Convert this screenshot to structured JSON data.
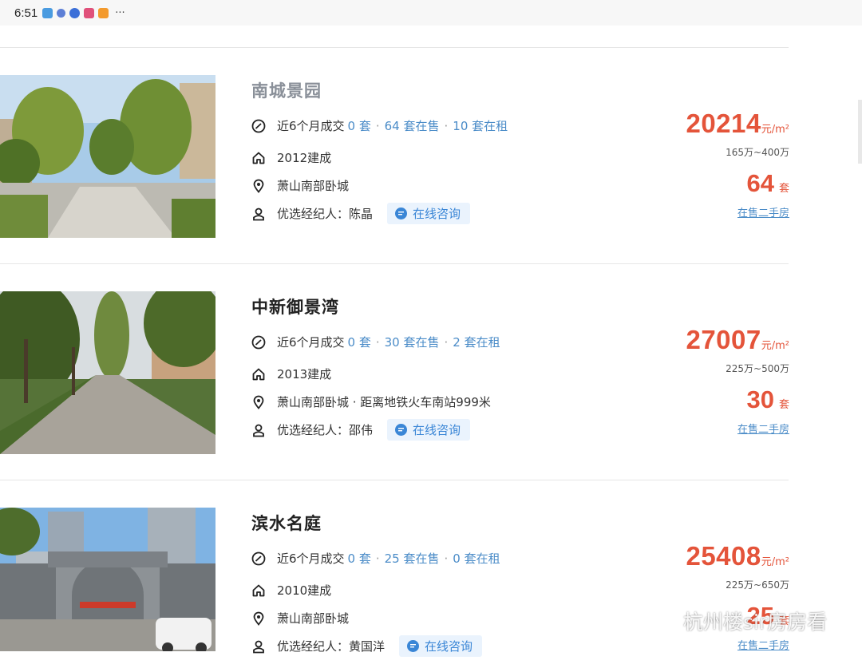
{
  "status_bar": {
    "time": "6:51",
    "more": "···"
  },
  "listings": [
    {
      "name": "南城景园",
      "deals_prefix": "近6个月成交",
      "deals": "0 套",
      "on_sale": "64 套在售",
      "for_rent": "10 套在租",
      "built": "2012建成",
      "location": "萧山南部卧城",
      "agent_label": "优选经纪人：",
      "agent": "陈晶",
      "consult": "在线咨询",
      "price": "20214",
      "price_unit": "元/m²",
      "price_range": "165万~400万",
      "count": "64",
      "count_unit": "套",
      "link": "在售二手房"
    },
    {
      "name": "中新御景湾",
      "deals_prefix": "近6个月成交",
      "deals": "0 套",
      "on_sale": "30 套在售",
      "for_rent": "2 套在租",
      "built": "2013建成",
      "location": "萧山南部卧城 · 距离地铁火车南站999米",
      "agent_label": "优选经纪人：",
      "agent": "邵伟",
      "consult": "在线咨询",
      "price": "27007",
      "price_unit": "元/m²",
      "price_range": "225万~500万",
      "count": "30",
      "count_unit": "套",
      "link": "在售二手房"
    },
    {
      "name": "滨水名庭",
      "deals_prefix": "近6个月成交",
      "deals": "0 套",
      "on_sale": "25 套在售",
      "for_rent": "0 套在租",
      "built": "2010建成",
      "location": "萧山南部卧城",
      "agent_label": "优选经纪人：",
      "agent": "黄国洋",
      "consult": "在线咨询",
      "price": "25408",
      "price_unit": "元/m²",
      "price_range": "225万~650万",
      "count": "25",
      "count_unit": "套",
      "link": "在售二手房"
    }
  ],
  "watermark": "杭州楼sir房房看",
  "colors": {
    "price": "#e4543a",
    "link": "#4b8cc8",
    "consult_bg": "#eaf3fd"
  }
}
